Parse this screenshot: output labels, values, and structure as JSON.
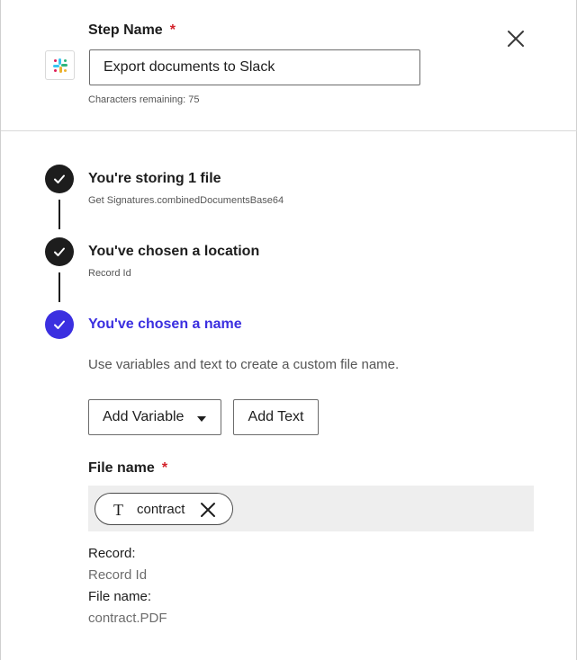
{
  "header": {
    "step_name_label": "Step Name",
    "required_mark": "*",
    "step_name_value": "Export documents to Slack",
    "characters_remaining": "Characters remaining: 75",
    "app_icon": "slack-icon"
  },
  "steps": [
    {
      "title": "You're storing 1 file",
      "subtitle": "Get Signatures.combinedDocumentsBase64",
      "status": "complete"
    },
    {
      "title": "You've chosen a location",
      "subtitle": "Record Id",
      "status": "complete"
    },
    {
      "title": "You've chosen a name",
      "status": "active"
    }
  ],
  "name_step": {
    "helper": "Use variables and text to create a custom file name.",
    "add_variable_label": "Add Variable",
    "add_text_label": "Add Text",
    "file_name_label": "File name",
    "required_mark": "*",
    "chip": {
      "type_icon": "T",
      "label": "contract"
    }
  },
  "summary": {
    "record_label": "Record:",
    "record_value": "Record Id",
    "file_name_label": "File name:",
    "file_name_value": "contract.PDF"
  },
  "colors": {
    "accent": "#3b2fe0",
    "complete": "#1d1d1d",
    "required": "#d3222a"
  }
}
